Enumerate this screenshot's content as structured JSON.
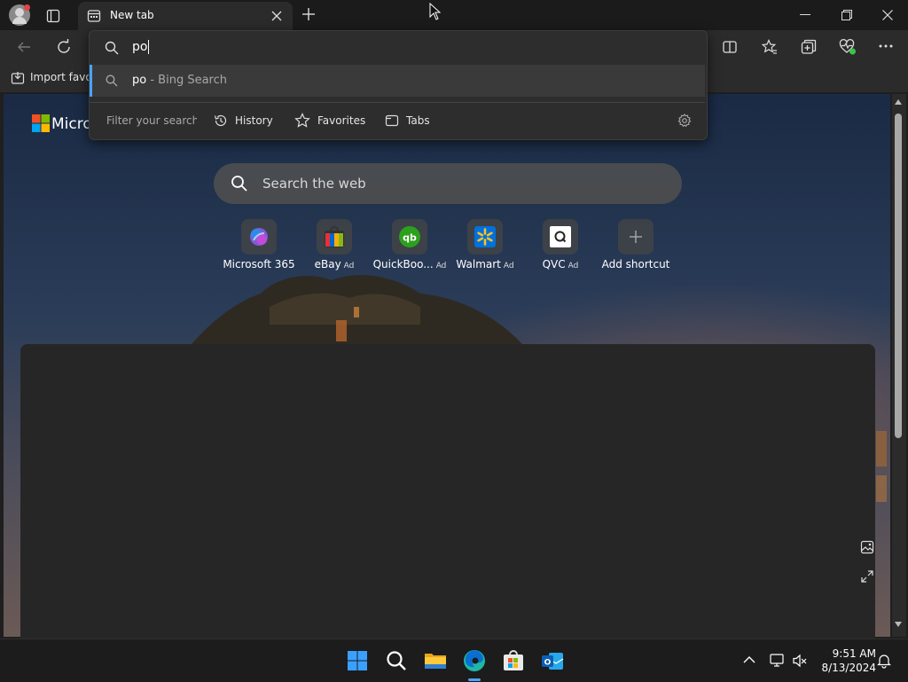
{
  "browser": {
    "tab_title": "New tab",
    "favorites_bar": {
      "import_label": "Import favorites"
    },
    "omnibox": {
      "query": "po",
      "suggestion": {
        "text": "po",
        "source": " - Bing Search"
      },
      "filter_label": "Filter your search:",
      "filters": [
        {
          "label": "History"
        },
        {
          "label": "Favorites"
        },
        {
          "label": "Tabs"
        }
      ]
    }
  },
  "newtab": {
    "brand_text": "Microsoft",
    "search_placeholder": "Search the web",
    "shortcuts": [
      {
        "label": "Microsoft 365",
        "ad": ""
      },
      {
        "label": "eBay",
        "ad": "Ad"
      },
      {
        "label": "QuickBoo...",
        "ad": "Ad"
      },
      {
        "label": "Walmart",
        "ad": "Ad"
      },
      {
        "label": "QVC",
        "ad": "Ad"
      },
      {
        "label": "Add shortcut",
        "ad": ""
      }
    ]
  },
  "taskbar": {
    "time": "9:51 AM",
    "date": "8/13/2024"
  },
  "colors": {
    "accent": "#4aa3ff",
    "edge_teal": "#1fb7a6",
    "quickbooks_green": "#2ca01c",
    "walmart_blue": "#0071dc"
  }
}
